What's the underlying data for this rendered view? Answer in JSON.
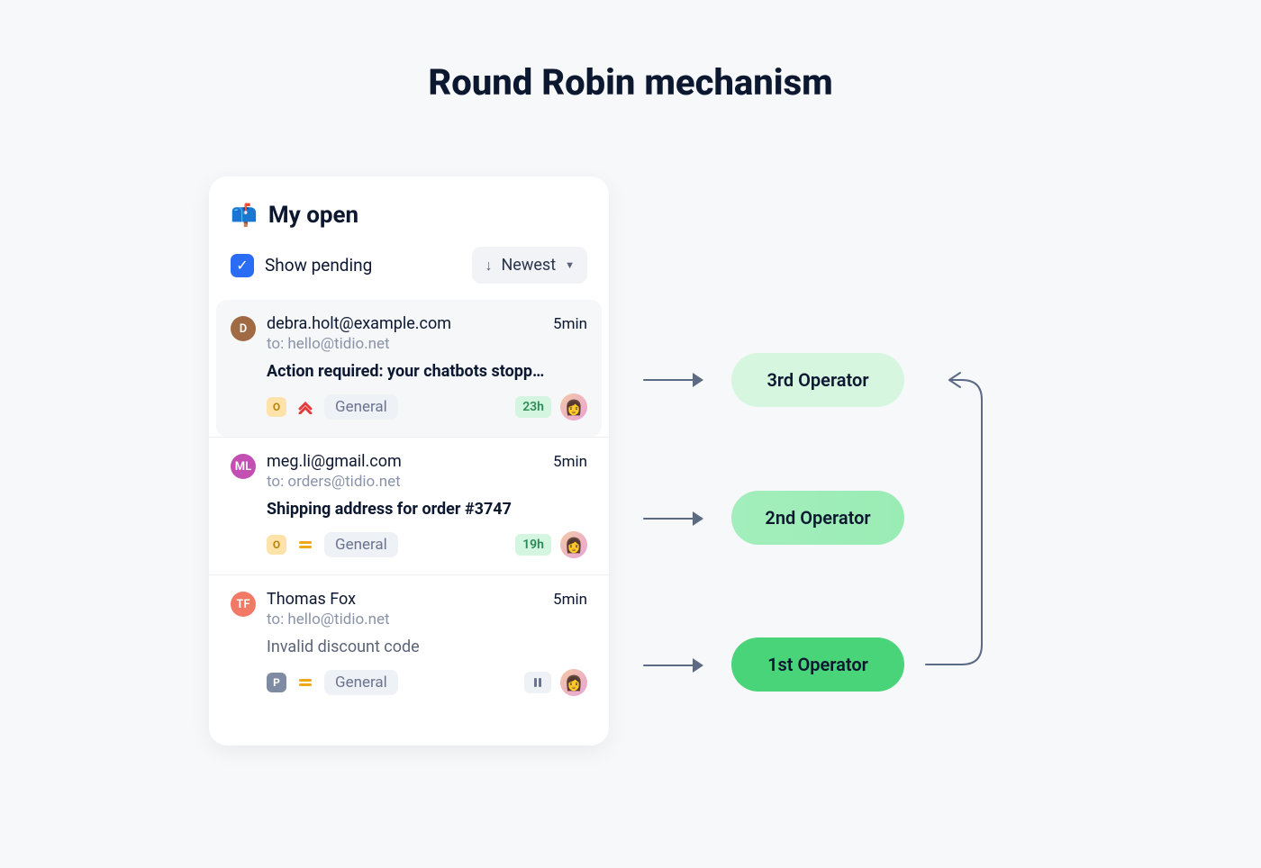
{
  "title": "Round Robin mechanism",
  "panel": {
    "icon": "📫",
    "title": "My open",
    "show_pending_label": "Show pending",
    "show_pending_checked": true,
    "sort_label": "Newest"
  },
  "items": [
    {
      "selected": true,
      "avatar_initial": "D",
      "avatar_color": "#a06a44",
      "sender": "debra.holt@example.com",
      "time": "5min",
      "to": "to: hello@tidio.net",
      "subject": "Action required: your chatbots stopp…",
      "subject_bold": true,
      "left_tag": "O",
      "left_tag_kind": "o",
      "priority": "high",
      "category": "General",
      "age": "23h",
      "right_icon": "age"
    },
    {
      "selected": false,
      "avatar_initial": "ML",
      "avatar_color": "#c24fb1",
      "sender": "meg.li@gmail.com",
      "time": "5min",
      "to": "to: orders@tidio.net",
      "subject": "Shipping address for order #3747",
      "subject_bold": true,
      "left_tag": "O",
      "left_tag_kind": "o",
      "priority": "medium",
      "category": "General",
      "age": "19h",
      "right_icon": "age"
    },
    {
      "selected": false,
      "avatar_initial": "TF",
      "avatar_color": "#f07a66",
      "sender": "Thomas Fox",
      "time": "5min",
      "to": "to: hello@tidio.net",
      "subject": "Invalid discount code",
      "subject_bold": false,
      "left_tag": "P",
      "left_tag_kind": "p",
      "priority": "medium",
      "category": "General",
      "age": "",
      "right_icon": "pause"
    }
  ],
  "operators": [
    {
      "label": "3rd Operator"
    },
    {
      "label": "2nd Operator"
    },
    {
      "label": "1st Operator"
    }
  ]
}
